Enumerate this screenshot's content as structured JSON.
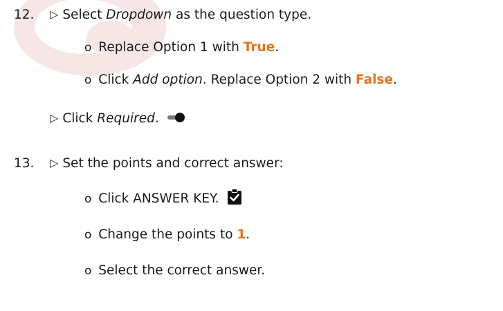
{
  "step12": {
    "number": "12.",
    "marker": "▷",
    "text1": "Select",
    "text2": "Dropdown",
    "text3": "as the question type.",
    "sub1": {
      "bullet": "o",
      "text": "Replace Option 1 with",
      "highlight": "True",
      "tail": "."
    },
    "sub2": {
      "bullet": "o",
      "text1": "Click",
      "text2": "Add option",
      "text3": ". Replace Option 2 with",
      "highlight": "False",
      "tail": "."
    },
    "required": {
      "marker": "▷",
      "text1": "Click",
      "text2": "Required",
      "text3": "."
    }
  },
  "step13": {
    "number": "13.",
    "marker": "▷",
    "text": "Set the points and correct answer:",
    "sub1": {
      "bullet": "o",
      "text": "Click ANSWER KEY."
    },
    "sub2": {
      "bullet": "o",
      "text": "Change the points to",
      "highlight": "1",
      "tail": "."
    },
    "sub3": {
      "bullet": "o",
      "text": "Select the correct answer."
    }
  },
  "colors": {
    "highlight": "#e8731a",
    "watermark": "#f3e1e1"
  },
  "icons": {
    "toggle": "toggle-on-icon",
    "answer_key": "assignment-check-icon",
    "marker": "triangle-right-icon"
  }
}
